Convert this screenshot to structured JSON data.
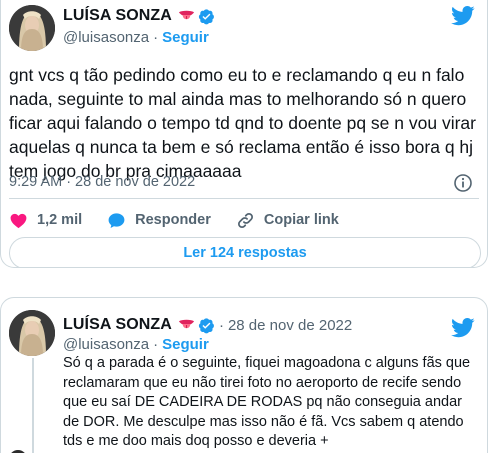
{
  "tweet1": {
    "author_name": "LUÍSA SONZA",
    "handle": "@luisasonza",
    "separator": "·",
    "follow_label": "Seguir",
    "text": "gnt vcs q tão pedindo como eu to e reclamando q eu n falo nada, seguinte to mal ainda mas to melhorando só n quero ficar aqui falando o tempo td qnd to doente pq se n vou virar aquelas q nunca ta bem e só reclama então é isso bora q hj tem jogo do br pra cimaaaaaa",
    "time": "9:29 AM",
    "date": "28 de nov de 2022",
    "likes_count": "1,2 mil",
    "reply_label": "Responder",
    "copy_link_label": "Copiar link",
    "read_replies_label": "Ler 124 respostas"
  },
  "tweet2": {
    "author_name": "LUÍSA SONZA",
    "date": "28 de nov de 2022",
    "separator": "·",
    "handle": "@luisasonza",
    "follow_label": "Seguir",
    "text": "Só q a parada é o seguinte, fiquei magoadona c alguns fãs que reclamaram que eu não tirei foto no aeroporto de recife sendo que eu saí DE CADEIRA DE RODAS pq não conseguia andar de DOR. Me desculpe mas isso não é fã. Vcs sabem q atendo tds e me doo mais doq posso e deveria +"
  },
  "icons": {
    "verified": "verified-badge-icon",
    "emoji": "tongue-emoji-icon",
    "platform": "twitter-bird-icon",
    "like": "heart-icon",
    "reply": "speech-bubble-icon",
    "copy_link": "link-icon",
    "info": "info-icon"
  },
  "colors": {
    "accent": "#1d9bf0",
    "like": "#f91880",
    "secondary_text": "#536471",
    "border": "#cfd9de"
  }
}
